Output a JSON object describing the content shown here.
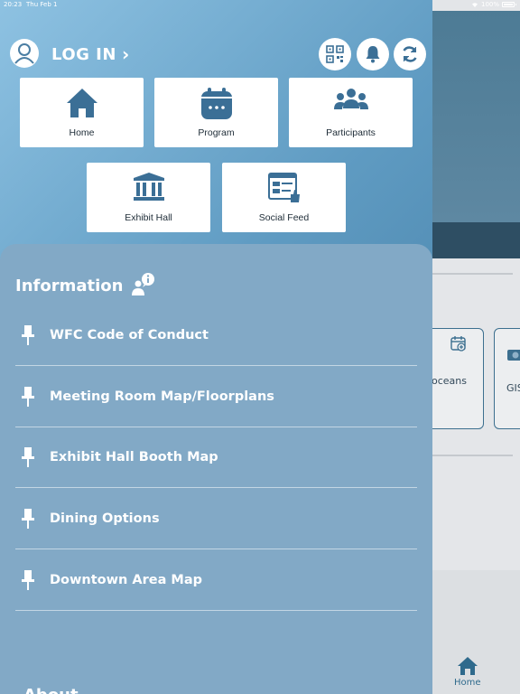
{
  "status_bar": {
    "time": "20:23",
    "date": "Thu Feb 1",
    "battery": "100%"
  },
  "header": {
    "login_label": "LOG IN",
    "login_chevron": "›"
  },
  "tiles": [
    {
      "label": "Home",
      "icon": "home-icon"
    },
    {
      "label": "Program",
      "icon": "calendar-icon"
    },
    {
      "label": "Participants",
      "icon": "people-icon"
    },
    {
      "label": "Exhibit Hall",
      "icon": "building-icon"
    },
    {
      "label": "Social Feed",
      "icon": "social-feed-icon"
    }
  ],
  "information": {
    "title": "Information",
    "items": [
      {
        "label": "WFC Code of Conduct"
      },
      {
        "label": "Meeting Room Map/Floorplans"
      },
      {
        "label": "Exhibit Hall Booth Map"
      },
      {
        "label": "Dining Options"
      },
      {
        "label": "Downtown Area Map"
      }
    ],
    "next_section": "About"
  },
  "background": {
    "card1_label": "oceans",
    "card2_label": "GIS",
    "bottom_tab_label": "Home"
  },
  "colors": {
    "accent": "#3d6f95",
    "panel": "#82a9c6",
    "tile_icon": "#3b6f96"
  }
}
